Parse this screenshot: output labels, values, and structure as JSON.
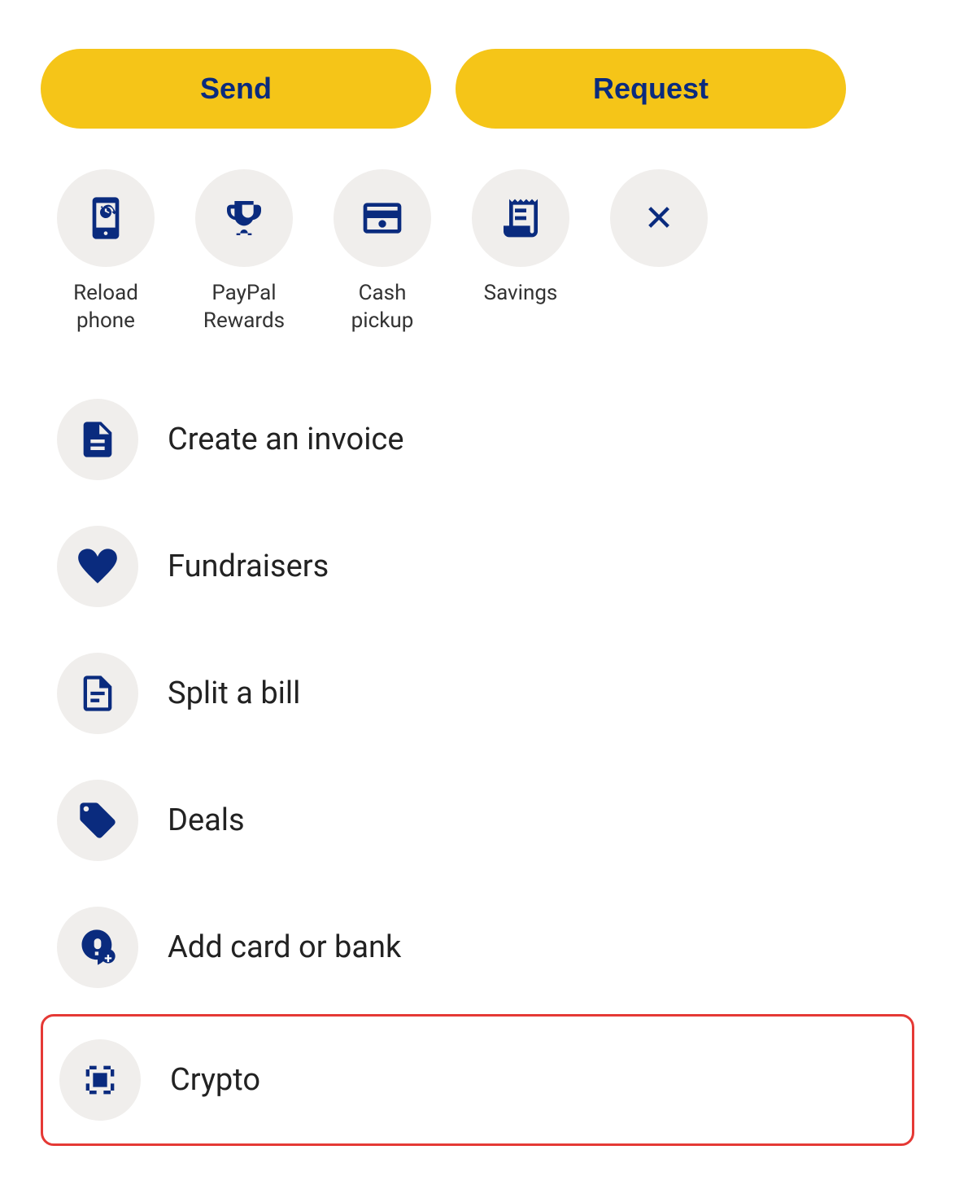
{
  "buttons": {
    "send_label": "Send",
    "request_label": "Request"
  },
  "quick_actions": [
    {
      "id": "reload-phone",
      "label": "Reload\nphone",
      "icon": "phone-reload"
    },
    {
      "id": "paypal-rewards",
      "label": "PayPal\nRewards",
      "icon": "trophy"
    },
    {
      "id": "cash-pickup",
      "label": "Cash\npickup",
      "icon": "cash-pickup"
    },
    {
      "id": "savings",
      "label": "Savings",
      "icon": "savings"
    },
    {
      "id": "close",
      "label": "",
      "icon": "close"
    }
  ],
  "menu_items": [
    {
      "id": "create-invoice",
      "label": "Create an invoice",
      "icon": "invoice",
      "highlighted": false
    },
    {
      "id": "fundraisers",
      "label": "Fundraisers",
      "icon": "fundraisers",
      "highlighted": false
    },
    {
      "id": "split-bill",
      "label": "Split a bill",
      "icon": "split-bill",
      "highlighted": false
    },
    {
      "id": "deals",
      "label": "Deals",
      "icon": "deals",
      "highlighted": false
    },
    {
      "id": "add-card-bank",
      "label": "Add card or bank",
      "icon": "add-bank",
      "highlighted": false
    },
    {
      "id": "crypto",
      "label": "Crypto",
      "icon": "crypto",
      "highlighted": true
    }
  ],
  "colors": {
    "accent_yellow": "#F5C518",
    "navy": "#0a2b7e",
    "highlight_red": "#e53935",
    "icon_bg": "#f0eeec"
  }
}
